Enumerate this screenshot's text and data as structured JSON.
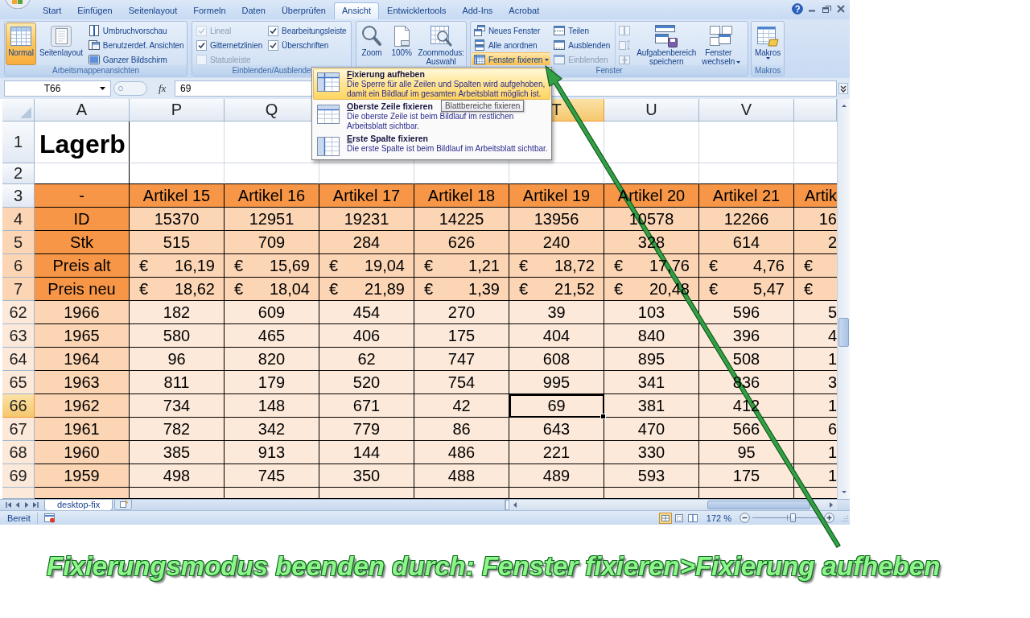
{
  "title_bar": {
    "tabs": [
      {
        "label": "Start",
        "selected": false
      },
      {
        "label": "Einfügen",
        "selected": false
      },
      {
        "label": "Seitenlayout",
        "selected": false
      },
      {
        "label": "Formeln",
        "selected": false
      },
      {
        "label": "Daten",
        "selected": false
      },
      {
        "label": "Überprüfen",
        "selected": false
      },
      {
        "label": "Ansicht",
        "selected": true
      },
      {
        "label": "Entwicklertools",
        "selected": false
      },
      {
        "label": "Add-Ins",
        "selected": false
      },
      {
        "label": "Acrobat",
        "selected": false
      }
    ]
  },
  "ribbon": {
    "groups": [
      {
        "label": "Arbeitsmappenansichten",
        "items": [
          {
            "kind": "large",
            "label": "Normal",
            "selected": true
          },
          {
            "kind": "large",
            "label": "Seitenlayout",
            "selected": false
          },
          {
            "kind": "small",
            "label": "Umbruchvorschau",
            "selected": false
          },
          {
            "kind": "small",
            "label": "Benutzerdef. Ansichten",
            "selected": false
          },
          {
            "kind": "small",
            "label": "Ganzer Bildschirm",
            "selected": false
          }
        ]
      },
      {
        "label": "Einblenden/Ausblende",
        "items": [
          {
            "kind": "checkbox",
            "label": "Lineal",
            "checked": true,
            "disabled": true
          },
          {
            "kind": "checkbox",
            "label": "Gitternetzlinien",
            "checked": true,
            "disabled": false
          },
          {
            "kind": "checkbox",
            "label": "Statusleiste",
            "checked": false,
            "disabled": true
          },
          {
            "kind": "checkbox",
            "label": "Bearbeitungsleiste",
            "checked": true,
            "disabled": false
          },
          {
            "kind": "checkbox",
            "label": "Überschriften",
            "checked": true,
            "disabled": false
          }
        ]
      },
      {
        "items": [
          {
            "kind": "large",
            "label": "Zoom"
          },
          {
            "kind": "large",
            "label": "100%"
          },
          {
            "kind": "large",
            "label": "Zoommodus: Auswahl"
          }
        ]
      },
      {
        "label": "Fenster",
        "items": [
          {
            "kind": "small",
            "label": "Neues Fenster",
            "expanded": false,
            "disabled": false,
            "dropdown": false
          },
          {
            "kind": "small",
            "label": "Alle anordnen",
            "expanded": false,
            "disabled": false,
            "dropdown": false
          },
          {
            "kind": "small",
            "label": "Fenster fixieren",
            "expanded": true,
            "disabled": false,
            "dropdown": true
          },
          {
            "kind": "small",
            "label": "Teilen",
            "expanded": false,
            "disabled": false,
            "dropdown": false
          },
          {
            "kind": "small",
            "label": "Ausblenden",
            "expanded": false,
            "disabled": false,
            "dropdown": false
          },
          {
            "kind": "small",
            "label": "Einblenden",
            "expanded": false,
            "disabled": true,
            "dropdown": false
          },
          {
            "kind": "icon",
            "expanded": false,
            "disabled": true,
            "dropdown": false
          },
          {
            "kind": "icon",
            "expanded": false,
            "disabled": true,
            "dropdown": false
          },
          {
            "kind": "icon",
            "expanded": false,
            "disabled": true,
            "dropdown": false
          },
          {
            "kind": "large",
            "label": "Aufgabenbereich speichern",
            "expanded": false,
            "disabled": false,
            "dropdown": false
          },
          {
            "kind": "large",
            "label": "Fenster wechseln",
            "expanded": false,
            "disabled": false,
            "dropdown": true
          }
        ]
      },
      {
        "label": "Makros",
        "items": [
          {
            "kind": "large",
            "label": "Makros",
            "dropdown": true
          }
        ]
      }
    ]
  },
  "formula_bar": {
    "name_box": "T66",
    "function_button": "fx",
    "value": "69"
  },
  "sheet": {
    "columns": [
      {
        "label": "A",
        "selected": false
      },
      {
        "label": "P",
        "selected": false
      },
      {
        "label": "Q",
        "selected": false
      },
      null,
      null,
      {
        "label": "T",
        "selected": true
      },
      {
        "label": "U",
        "selected": false
      },
      {
        "label": "V",
        "selected": false
      },
      null
    ],
    "rows": [
      {
        "header": "1",
        "selected": false,
        "kind": "title",
        "label": "Lagerb"
      },
      {
        "header": "2",
        "selected": false,
        "kind": "blank"
      },
      {
        "header": "3",
        "selected": false,
        "kind": "heading",
        "label": "-",
        "cells": [
          "Artikel 15",
          "Artikel 16",
          "Artikel 17",
          "Artikel 18",
          "Artikel 19",
          "Artikel 20",
          "Artikel 21",
          "Artik"
        ]
      },
      {
        "header": "4",
        "selected": false,
        "kind": "detail",
        "label": "ID",
        "cells": [
          "15370",
          "12951",
          "19231",
          "14225",
          "13956",
          "10578",
          "12266",
          "16"
        ]
      },
      {
        "header": "5",
        "selected": false,
        "kind": "detail",
        "label": "Stk",
        "cells": [
          "515",
          "709",
          "284",
          "626",
          "240",
          "328",
          "614",
          "2"
        ]
      },
      {
        "header": "6",
        "selected": false,
        "kind": "currency",
        "label": "Preis alt",
        "cells": [
          {
            "symbol": "€",
            "amount": "16,19"
          },
          {
            "symbol": "€",
            "amount": "15,69"
          },
          {
            "symbol": "€",
            "amount": "19,04"
          },
          {
            "symbol": "€",
            "amount": "1,21"
          },
          {
            "symbol": "€",
            "amount": "18,72"
          },
          {
            "symbol": "€",
            "amount": "17,76"
          },
          {
            "symbol": "€",
            "amount": "4,76"
          },
          {
            "symbol": "€"
          }
        ]
      },
      {
        "header": "7",
        "selected": false,
        "kind": "currency",
        "label": "Preis neu",
        "cells": [
          {
            "symbol": "€",
            "amount": "18,62"
          },
          {
            "symbol": "€",
            "amount": "18,04"
          },
          {
            "symbol": "€",
            "amount": "21,89"
          },
          {
            "symbol": "€",
            "amount": "1,39"
          },
          {
            "symbol": "€",
            "amount": "21,52"
          },
          {
            "symbol": "€",
            "amount": "20,48"
          },
          {
            "symbol": "€",
            "amount": "5,47"
          },
          {
            "symbol": "€"
          }
        ]
      },
      {
        "header": "62",
        "selected": false,
        "kind": "body",
        "label": "1966",
        "cells": [
          "182",
          "609",
          "454",
          "270",
          "39",
          "103",
          "596",
          "5"
        ]
      },
      {
        "header": "63",
        "selected": false,
        "kind": "body",
        "label": "1965",
        "cells": [
          "580",
          "465",
          "406",
          "175",
          "404",
          "840",
          "396",
          "4"
        ]
      },
      {
        "header": "64",
        "selected": false,
        "kind": "body",
        "label": "1964",
        "cells": [
          "96",
          "820",
          "62",
          "747",
          "608",
          "895",
          "508",
          "1"
        ]
      },
      {
        "header": "65",
        "selected": false,
        "kind": "body",
        "label": "1963",
        "cells": [
          "811",
          "179",
          "520",
          "754",
          "995",
          "341",
          "836",
          "3"
        ]
      },
      {
        "header": "66",
        "selected": true,
        "kind": "body",
        "label": "1962",
        "cells": [
          "734",
          "148",
          "671",
          "42",
          "69",
          "381",
          "412",
          "1"
        ]
      },
      {
        "header": "67",
        "selected": false,
        "kind": "body",
        "label": "1961",
        "cells": [
          "782",
          "342",
          "779",
          "86",
          "643",
          "470",
          "566",
          "6"
        ]
      },
      {
        "header": "68",
        "selected": false,
        "kind": "body",
        "label": "1960",
        "cells": [
          "385",
          "913",
          "144",
          "486",
          "221",
          "330",
          "95",
          "1"
        ]
      },
      {
        "header": "69",
        "selected": false,
        "kind": "body",
        "label": "1959",
        "cells": [
          "498",
          "745",
          "350",
          "488",
          "489",
          "593",
          "175",
          "1"
        ]
      }
    ]
  },
  "sheet_tabs": {
    "tabs": [
      {
        "label": "desktop-fix",
        "selected": true
      }
    ]
  },
  "status_bar": {
    "status": "Bereit",
    "zoom": "172 %",
    "zoom_slider": {
      "level": 0.58
    }
  },
  "freeze_menu": {
    "items": [
      {
        "title": "Fixierung aufheben",
        "description": "Die Sperre für alle Zeilen und Spalten wird aufgehoben, damit ein Bildlauf im gesamten Arbeitsblatt möglich ist.",
        "selected": true
      },
      {
        "title": "Oberste Zeile fixieren",
        "description": "Die oberste Zeile ist beim Bildlauf im restlichen Arbeitsblatt sichtbar.",
        "selected": false
      },
      {
        "title": "Erste Spalte fixieren",
        "description": "Die erste Spalte ist beim Bildlauf im Arbeitsblatt sichtbar.",
        "selected": false
      }
    ],
    "tooltip": "Blattbereiche fixieren"
  },
  "caption": "Fixierungsmodus beenden durch: Fenster fixieren>Fixierung aufheben"
}
